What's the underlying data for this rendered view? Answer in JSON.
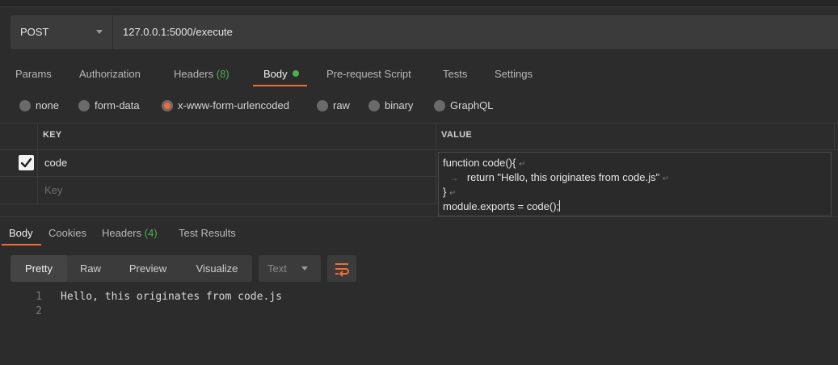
{
  "request": {
    "method": "POST",
    "url": "127.0.0.1:5000/execute"
  },
  "request_tabs": [
    {
      "label": "Params"
    },
    {
      "label": "Authorization"
    },
    {
      "label": "Headers",
      "count": "(8)"
    },
    {
      "label": "Body"
    },
    {
      "label": "Pre-request Script"
    },
    {
      "label": "Tests"
    },
    {
      "label": "Settings"
    }
  ],
  "body_types": [
    "none",
    "form-data",
    "x-www-form-urlencoded",
    "raw",
    "binary",
    "GraphQL"
  ],
  "body_type_selected": "x-www-form-urlencoded",
  "table": {
    "key_header": "KEY",
    "value_header": "VALUE",
    "rows": [
      {
        "key": "code",
        "checked": true
      }
    ],
    "key_placeholder": "Key"
  },
  "value_editor": {
    "lines": [
      "function code(){",
      "return \"Hello, this originates from code.js\"",
      "}",
      "module.exports = code();"
    ]
  },
  "response_tabs": [
    {
      "label": "Body"
    },
    {
      "label": "Cookies"
    },
    {
      "label": "Headers",
      "count": "(4)"
    },
    {
      "label": "Test Results"
    }
  ],
  "view_modes": [
    "Pretty",
    "Raw",
    "Preview",
    "Visualize"
  ],
  "format": "Text",
  "response_lines": [
    {
      "n": "1",
      "text": "Hello, this originates from code.js"
    },
    {
      "n": "2",
      "text": ""
    }
  ],
  "colors": {
    "accent": "#f26b3a",
    "green": "#4caf50",
    "background": "#2c2c2c"
  },
  "icons": [
    "chevron-down-icon",
    "checkbox-checked-icon",
    "wrap-lines-icon",
    "radio-icon"
  ]
}
